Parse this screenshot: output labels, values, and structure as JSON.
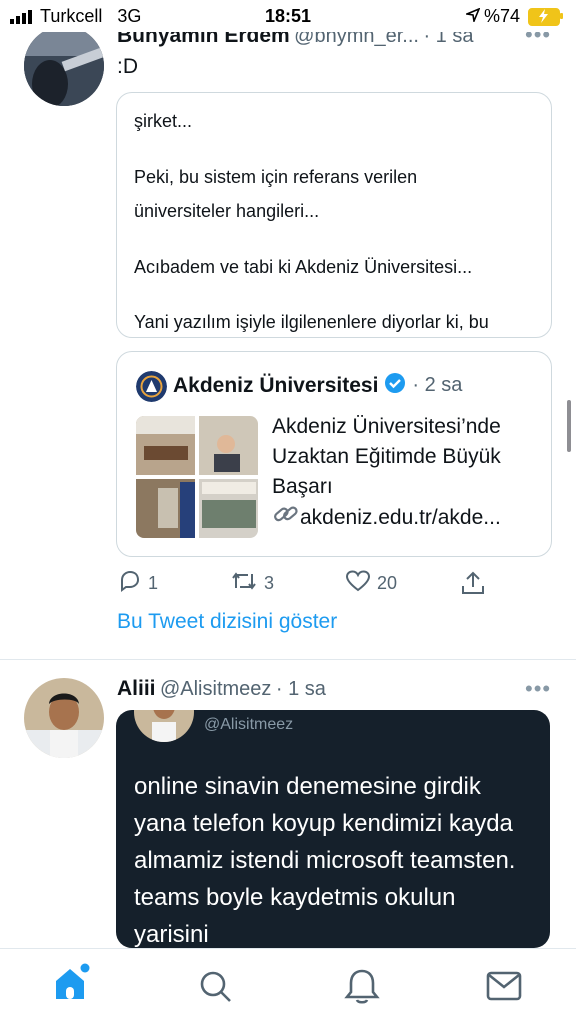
{
  "status_bar": {
    "carrier": "Turkcell",
    "network": "3G",
    "time": "18:51",
    "battery": "%74"
  },
  "tweet1": {
    "name": "Bünyamin Erdem",
    "handle": "@bnymn_er...",
    "time": "· 1 sa",
    "text": ":D",
    "quoted_lines": [
      "şirket...",
      "Peki, bu sistem için referans verilen",
      "üniversiteler hangileri...",
      "Acıbadem ve tabi ki Akdeniz Üniversitesi...",
      "Yani yazılım işiyle ilgilenenlere diyorlar ki, bu"
    ],
    "link_card": {
      "account": "Akdeniz Üniversitesi",
      "time": "· 2 sa",
      "title_lines": [
        "Akdeniz Üniversitesi’nde",
        "Uzaktan Eğitimde Büyük",
        "Başarı"
      ],
      "url": "akdeniz.edu.tr/akde..."
    },
    "actions": {
      "replies": "1",
      "retweets": "3",
      "likes": "20"
    },
    "thread_link": "Bu Tweet dizisini göster"
  },
  "tweet2": {
    "name": "Aliii",
    "handle": "@Alisitmeez",
    "time": "· 1 sa",
    "image_handle": "@Alisitmeez",
    "image_lines": [
      "online sinavin denemesine girdik",
      "yana telefon koyup kendimizi kayda",
      "almamiz istendi microsoft teamsten.",
      "teams boyle kaydetmis okulun",
      "yarisini"
    ]
  },
  "colors": {
    "accent": "#1d9bf0",
    "dark_card": "#15202b",
    "verified": "#1d9bf0"
  },
  "tab_icons": [
    "home-icon",
    "search-icon",
    "notifications-icon",
    "messages-icon"
  ]
}
